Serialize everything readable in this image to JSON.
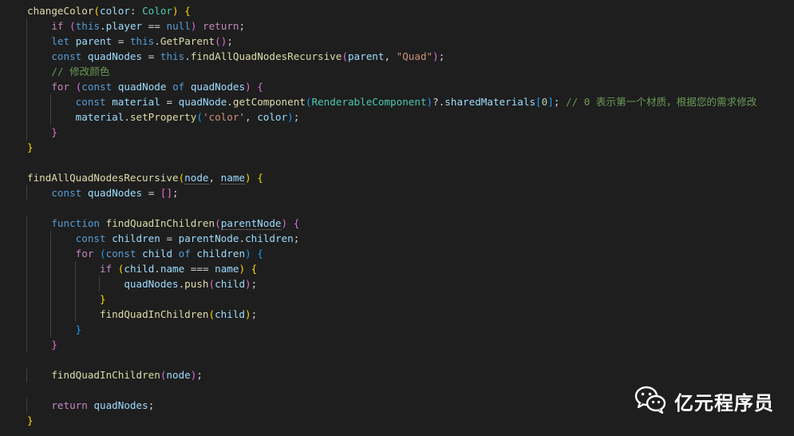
{
  "code_lines": [
    [
      [
        "fn",
        "changeColor"
      ],
      [
        "b1",
        "("
      ],
      [
        "var",
        "color"
      ],
      [
        "pun",
        ": "
      ],
      [
        "cls",
        "Color"
      ],
      [
        "b1",
        ")"
      ],
      [
        "pun",
        " "
      ],
      [
        "b1",
        "{"
      ]
    ],
    [
      [
        "pun",
        "    "
      ],
      [
        "kw",
        "if"
      ],
      [
        "pun",
        " "
      ],
      [
        "b2",
        "("
      ],
      [
        "st",
        "this"
      ],
      [
        "pun",
        "."
      ],
      [
        "var",
        "player"
      ],
      [
        "pun",
        " == "
      ],
      [
        "st",
        "null"
      ],
      [
        "b2",
        ")"
      ],
      [
        "pun",
        " "
      ],
      [
        "kw",
        "return"
      ],
      [
        "pun",
        ";"
      ]
    ],
    [
      [
        "pun",
        "    "
      ],
      [
        "st",
        "let"
      ],
      [
        "pun",
        " "
      ],
      [
        "var",
        "parent"
      ],
      [
        "pun",
        " = "
      ],
      [
        "st",
        "this"
      ],
      [
        "pun",
        "."
      ],
      [
        "fn",
        "GetParent"
      ],
      [
        "b2",
        "("
      ],
      [
        "b2",
        ")"
      ],
      [
        "pun",
        ";"
      ]
    ],
    [
      [
        "pun",
        "    "
      ],
      [
        "st",
        "const"
      ],
      [
        "pun",
        " "
      ],
      [
        "var",
        "quadNodes"
      ],
      [
        "pun",
        " = "
      ],
      [
        "st",
        "this"
      ],
      [
        "pun",
        "."
      ],
      [
        "fn",
        "findAllQuadNodesRecursive"
      ],
      [
        "b2",
        "("
      ],
      [
        "var",
        "parent"
      ],
      [
        "pun",
        ", "
      ],
      [
        "str",
        "\"Quad\""
      ],
      [
        "b2",
        ")"
      ],
      [
        "pun",
        ";"
      ]
    ],
    [
      [
        "pun",
        "    "
      ],
      [
        "com",
        "// 修改颜色"
      ]
    ],
    [
      [
        "pun",
        "    "
      ],
      [
        "kw",
        "for"
      ],
      [
        "pun",
        " "
      ],
      [
        "b2",
        "("
      ],
      [
        "st",
        "const"
      ],
      [
        "pun",
        " "
      ],
      [
        "var",
        "quadNode"
      ],
      [
        "pun",
        " "
      ],
      [
        "st",
        "of"
      ],
      [
        "pun",
        " "
      ],
      [
        "var",
        "quadNodes"
      ],
      [
        "b2",
        ")"
      ],
      [
        "pun",
        " "
      ],
      [
        "b2",
        "{"
      ]
    ],
    [
      [
        "pun",
        "        "
      ],
      [
        "st",
        "const"
      ],
      [
        "pun",
        " "
      ],
      [
        "var",
        "material"
      ],
      [
        "pun",
        " = "
      ],
      [
        "var",
        "quadNode"
      ],
      [
        "pun",
        "."
      ],
      [
        "fn",
        "getComponent"
      ],
      [
        "b3",
        "("
      ],
      [
        "cls",
        "RenderableComponent"
      ],
      [
        "b3",
        ")"
      ],
      [
        "pun",
        "?."
      ],
      [
        "var",
        "sharedMaterials"
      ],
      [
        "b3",
        "["
      ],
      [
        "num",
        "0"
      ],
      [
        "b3",
        "]"
      ],
      [
        "pun",
        "; "
      ],
      [
        "com",
        "// 0 表示第一个材质，根据您的需求修改"
      ]
    ],
    [
      [
        "pun",
        "        "
      ],
      [
        "var",
        "material"
      ],
      [
        "pun",
        "."
      ],
      [
        "fn",
        "setProperty"
      ],
      [
        "b3",
        "("
      ],
      [
        "str",
        "'color'"
      ],
      [
        "pun",
        ", "
      ],
      [
        "var",
        "color"
      ],
      [
        "b3",
        ")"
      ],
      [
        "pun",
        ";"
      ]
    ],
    [
      [
        "pun",
        "    "
      ],
      [
        "b2",
        "}"
      ]
    ],
    [
      [
        "b1",
        "}"
      ]
    ],
    [],
    [
      [
        "fn",
        "findAllQuadNodesRecursive"
      ],
      [
        "b1",
        "("
      ],
      [
        "var",
        "node"
      ],
      [
        "pun",
        ", "
      ],
      [
        "var",
        "name"
      ],
      [
        "b1",
        ")"
      ],
      [
        "pun",
        " "
      ],
      [
        "b1",
        "{"
      ]
    ],
    [
      [
        "pun",
        "    "
      ],
      [
        "st",
        "const"
      ],
      [
        "pun",
        " "
      ],
      [
        "var",
        "quadNodes"
      ],
      [
        "pun",
        " = "
      ],
      [
        "b2",
        "["
      ],
      [
        "b2",
        "]"
      ],
      [
        "pun",
        ";"
      ]
    ],
    [],
    [
      [
        "pun",
        "    "
      ],
      [
        "st",
        "function"
      ],
      [
        "pun",
        " "
      ],
      [
        "fn",
        "findQuadInChildren"
      ],
      [
        "b2",
        "("
      ],
      [
        "var",
        "parentNode"
      ],
      [
        "b2",
        ")"
      ],
      [
        "pun",
        " "
      ],
      [
        "b2",
        "{"
      ]
    ],
    [
      [
        "pun",
        "        "
      ],
      [
        "st",
        "const"
      ],
      [
        "pun",
        " "
      ],
      [
        "var",
        "children"
      ],
      [
        "pun",
        " = "
      ],
      [
        "var",
        "parentNode"
      ],
      [
        "pun",
        "."
      ],
      [
        "var",
        "children"
      ],
      [
        "pun",
        ";"
      ]
    ],
    [
      [
        "pun",
        "        "
      ],
      [
        "kw",
        "for"
      ],
      [
        "pun",
        " "
      ],
      [
        "b3",
        "("
      ],
      [
        "st",
        "const"
      ],
      [
        "pun",
        " "
      ],
      [
        "var",
        "child"
      ],
      [
        "pun",
        " "
      ],
      [
        "st",
        "of"
      ],
      [
        "pun",
        " "
      ],
      [
        "var",
        "children"
      ],
      [
        "b3",
        ")"
      ],
      [
        "pun",
        " "
      ],
      [
        "b3",
        "{"
      ]
    ],
    [
      [
        "pun",
        "            "
      ],
      [
        "kw",
        "if"
      ],
      [
        "pun",
        " "
      ],
      [
        "b1",
        "("
      ],
      [
        "var",
        "child"
      ],
      [
        "pun",
        "."
      ],
      [
        "var",
        "name"
      ],
      [
        "pun",
        " === "
      ],
      [
        "var",
        "name"
      ],
      [
        "b1",
        ")"
      ],
      [
        "pun",
        " "
      ],
      [
        "b1",
        "{"
      ]
    ],
    [
      [
        "pun",
        "                "
      ],
      [
        "var",
        "quadNodes"
      ],
      [
        "pun",
        "."
      ],
      [
        "fn",
        "push"
      ],
      [
        "b2",
        "("
      ],
      [
        "var",
        "child"
      ],
      [
        "b2",
        ")"
      ],
      [
        "pun",
        ";"
      ]
    ],
    [
      [
        "pun",
        "            "
      ],
      [
        "b1",
        "}"
      ]
    ],
    [
      [
        "pun",
        "            "
      ],
      [
        "fn",
        "findQuadInChildren"
      ],
      [
        "b1",
        "("
      ],
      [
        "var",
        "child"
      ],
      [
        "b1",
        ")"
      ],
      [
        "pun",
        ";"
      ]
    ],
    [
      [
        "pun",
        "        "
      ],
      [
        "b3",
        "}"
      ]
    ],
    [
      [
        "pun",
        "    "
      ],
      [
        "b2",
        "}"
      ]
    ],
    [],
    [
      [
        "pun",
        "    "
      ],
      [
        "fn",
        "findQuadInChildren"
      ],
      [
        "b2",
        "("
      ],
      [
        "var",
        "node"
      ],
      [
        "b2",
        ")"
      ],
      [
        "pun",
        ";"
      ]
    ],
    [],
    [
      [
        "pun",
        "    "
      ],
      [
        "kw",
        "return"
      ],
      [
        "pun",
        " "
      ],
      [
        "var",
        "quadNodes"
      ],
      [
        "pun",
        ";"
      ]
    ],
    [
      [
        "b1",
        "}"
      ]
    ]
  ],
  "watermark": {
    "icon": "wechat-icon",
    "text": "亿元程序员"
  },
  "colors": {
    "background": "#1e1e1e",
    "function": "#dcdcaa",
    "control_keyword": "#c586c0",
    "storage_keyword": "#569cd6",
    "variable": "#9cdcfe",
    "class": "#4ec9b0",
    "string": "#ce9178",
    "number": "#b5cea8",
    "comment": "#6a9955"
  }
}
